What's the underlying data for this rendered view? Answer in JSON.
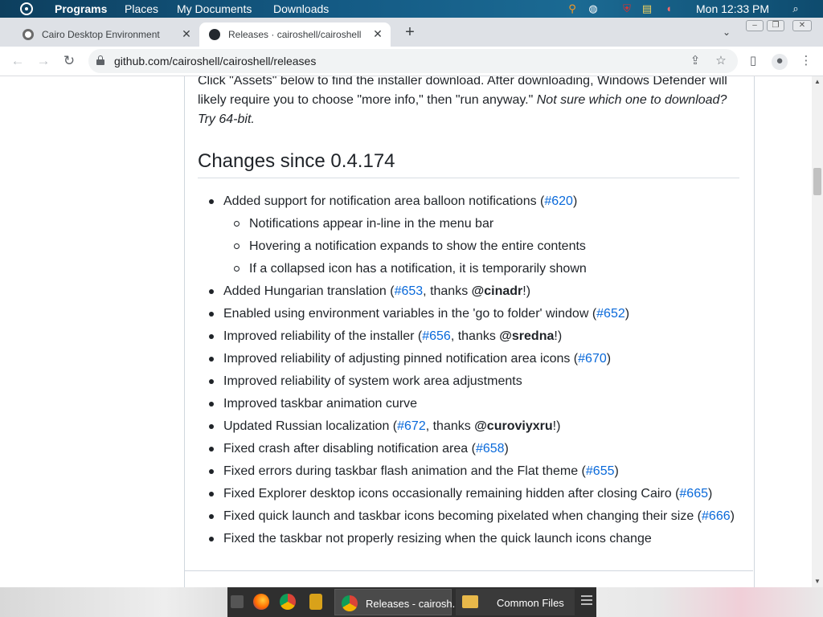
{
  "menubar": {
    "items": [
      "Programs",
      "Places",
      "My Documents",
      "Downloads"
    ],
    "clock": "Mon 12:33 PM",
    "colors": {
      "background": "#145a84"
    }
  },
  "browser": {
    "tabs": [
      {
        "title": "Cairo Desktop Environment",
        "active": false,
        "icon": "cairo-icon"
      },
      {
        "title": "Releases · cairoshell/cairoshell",
        "active": true,
        "icon": "github-icon"
      }
    ],
    "url": "github.com/cairoshell/cairoshell/releases"
  },
  "page": {
    "intro_text": "Click \"Assets\" below to find the installer download. After downloading, Windows Defender will likely require you to choose \"more info,\" then \"run anyway.\"",
    "intro_italic": "Not sure which one to download? Try 64-bit.",
    "heading": "Changes since 0.4.174",
    "changes": [
      {
        "pre": "Added support for notification area balloon notifications (",
        "link": "#620",
        "mid": "",
        "bold": "",
        "post": ")"
      },
      {
        "pre": "Notifications appear in-line in the menu bar",
        "sub": true
      },
      {
        "pre": "Hovering a notification expands to show the entire contents",
        "sub": true
      },
      {
        "pre": "If a collapsed icon has a notification, it is temporarily shown",
        "sub": true
      },
      {
        "pre": "Added Hungarian translation (",
        "link": "#653",
        "mid": ", thanks ",
        "bold": "@cinadr",
        "post": "!)"
      },
      {
        "pre": "Enabled using environment variables in the 'go to folder' window (",
        "link": "#652",
        "mid": "",
        "bold": "",
        "post": ")"
      },
      {
        "pre": "Improved reliability of the installer (",
        "link": "#656",
        "mid": ", thanks ",
        "bold": "@sredna",
        "post": "!)"
      },
      {
        "pre": "Improved reliability of adjusting pinned notification area icons (",
        "link": "#670",
        "mid": "",
        "bold": "",
        "post": ")"
      },
      {
        "pre": "Improved reliability of system work area adjustments"
      },
      {
        "pre": "Improved taskbar animation curve"
      },
      {
        "pre": "Updated Russian localization (",
        "link": "#672",
        "mid": ", thanks ",
        "bold": "@curoviyxru",
        "post": "!)"
      },
      {
        "pre": "Fixed crash after disabling notification area (",
        "link": "#658",
        "mid": "",
        "bold": "",
        "post": ")"
      },
      {
        "pre": "Fixed errors during taskbar flash animation and the Flat theme (",
        "link": "#655",
        "mid": "",
        "bold": "",
        "post": ")"
      },
      {
        "pre": "Fixed Explorer desktop icons occasionally remaining hidden after closing Cairo (",
        "link": "#665",
        "mid": "",
        "bold": "",
        "post": ")"
      },
      {
        "pre": "Fixed quick launch and taskbar icons becoming pixelated when changing their size (",
        "link": "#666",
        "mid": "",
        "bold": "",
        "post": ")"
      },
      {
        "pre": "Fixed the taskbar not properly resizing when the quick launch icons change"
      }
    ],
    "colors": {
      "text": "#1f2328",
      "link": "#0969da"
    }
  },
  "taskbar": {
    "tasks": [
      {
        "label": "Releases - cairosh...",
        "icon": "chrome-icon",
        "active": true
      },
      {
        "label": "Common Files",
        "icon": "folder-icon",
        "active": false
      }
    ],
    "quicklaunch": [
      "desktop-icon",
      "firefox-icon",
      "chrome-icon",
      "files-icon"
    ]
  }
}
